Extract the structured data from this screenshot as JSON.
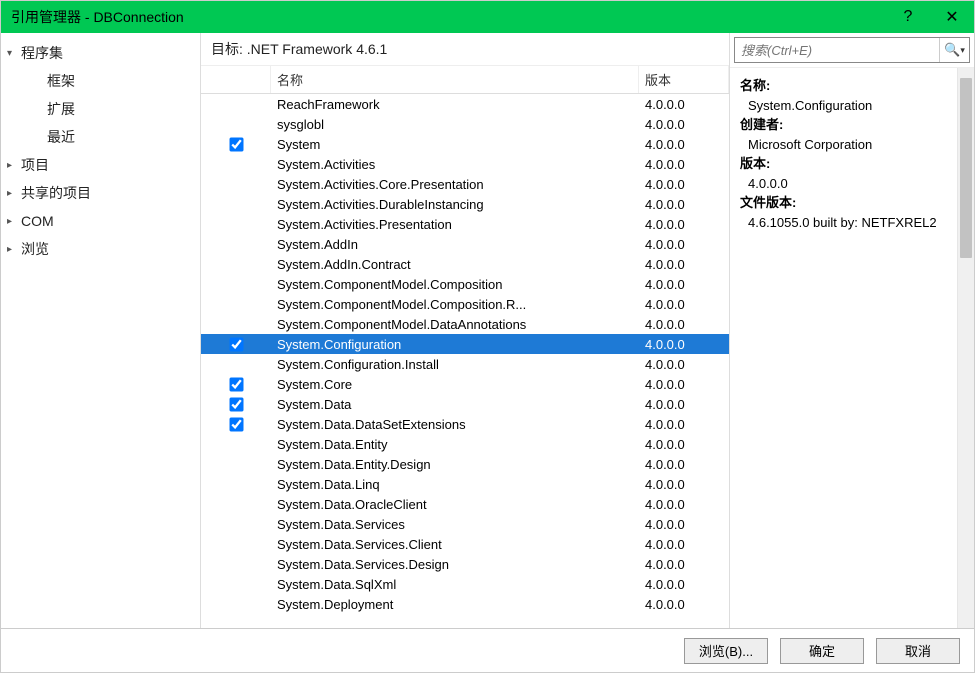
{
  "window": {
    "title": "引用管理器 - DBConnection",
    "help": "?",
    "close": "✕"
  },
  "nav": [
    {
      "label": "程序集",
      "type": "expanded",
      "children": [
        {
          "label": "框架"
        },
        {
          "label": "扩展"
        },
        {
          "label": "最近"
        }
      ]
    },
    {
      "label": "项目",
      "type": "collapsed"
    },
    {
      "label": "共享的项目",
      "type": "collapsed"
    },
    {
      "label": "COM",
      "type": "collapsed"
    },
    {
      "label": "浏览",
      "type": "collapsed"
    }
  ],
  "target": "目标: .NET Framework 4.6.1",
  "columns": {
    "check": "",
    "name": "名称",
    "version": "版本"
  },
  "assemblies": [
    {
      "checked": false,
      "name": "ReachFramework",
      "version": "4.0.0.0"
    },
    {
      "checked": false,
      "name": "sysglobl",
      "version": "4.0.0.0"
    },
    {
      "checked": true,
      "name": "System",
      "version": "4.0.0.0"
    },
    {
      "checked": false,
      "name": "System.Activities",
      "version": "4.0.0.0"
    },
    {
      "checked": false,
      "name": "System.Activities.Core.Presentation",
      "version": "4.0.0.0"
    },
    {
      "checked": false,
      "name": "System.Activities.DurableInstancing",
      "version": "4.0.0.0"
    },
    {
      "checked": false,
      "name": "System.Activities.Presentation",
      "version": "4.0.0.0"
    },
    {
      "checked": false,
      "name": "System.AddIn",
      "version": "4.0.0.0"
    },
    {
      "checked": false,
      "name": "System.AddIn.Contract",
      "version": "4.0.0.0"
    },
    {
      "checked": false,
      "name": "System.ComponentModel.Composition",
      "version": "4.0.0.0"
    },
    {
      "checked": false,
      "name": "System.ComponentModel.Composition.R...",
      "version": "4.0.0.0"
    },
    {
      "checked": false,
      "name": "System.ComponentModel.DataAnnotations",
      "version": "4.0.0.0"
    },
    {
      "checked": true,
      "name": "System.Configuration",
      "version": "4.0.0.0",
      "selected": true
    },
    {
      "checked": false,
      "name": "System.Configuration.Install",
      "version": "4.0.0.0"
    },
    {
      "checked": true,
      "name": "System.Core",
      "version": "4.0.0.0"
    },
    {
      "checked": true,
      "name": "System.Data",
      "version": "4.0.0.0"
    },
    {
      "checked": true,
      "name": "System.Data.DataSetExtensions",
      "version": "4.0.0.0"
    },
    {
      "checked": false,
      "name": "System.Data.Entity",
      "version": "4.0.0.0"
    },
    {
      "checked": false,
      "name": "System.Data.Entity.Design",
      "version": "4.0.0.0"
    },
    {
      "checked": false,
      "name": "System.Data.Linq",
      "version": "4.0.0.0"
    },
    {
      "checked": false,
      "name": "System.Data.OracleClient",
      "version": "4.0.0.0"
    },
    {
      "checked": false,
      "name": "System.Data.Services",
      "version": "4.0.0.0"
    },
    {
      "checked": false,
      "name": "System.Data.Services.Client",
      "version": "4.0.0.0"
    },
    {
      "checked": false,
      "name": "System.Data.Services.Design",
      "version": "4.0.0.0"
    },
    {
      "checked": false,
      "name": "System.Data.SqlXml",
      "version": "4.0.0.0"
    },
    {
      "checked": false,
      "name": "System.Deployment",
      "version": "4.0.0.0"
    }
  ],
  "search": {
    "placeholder": "搜索(Ctrl+E)"
  },
  "details": {
    "name_label": "名称:",
    "name_value": "System.Configuration",
    "creator_label": "创建者:",
    "creator_value": "Microsoft Corporation",
    "version_label": "版本:",
    "version_value": "4.0.0.0",
    "filever_label": "文件版本:",
    "filever_value": "4.6.1055.0 built by: NETFXREL2"
  },
  "footer": {
    "browse": "浏览(B)...",
    "ok": "确定",
    "cancel": "取消"
  }
}
